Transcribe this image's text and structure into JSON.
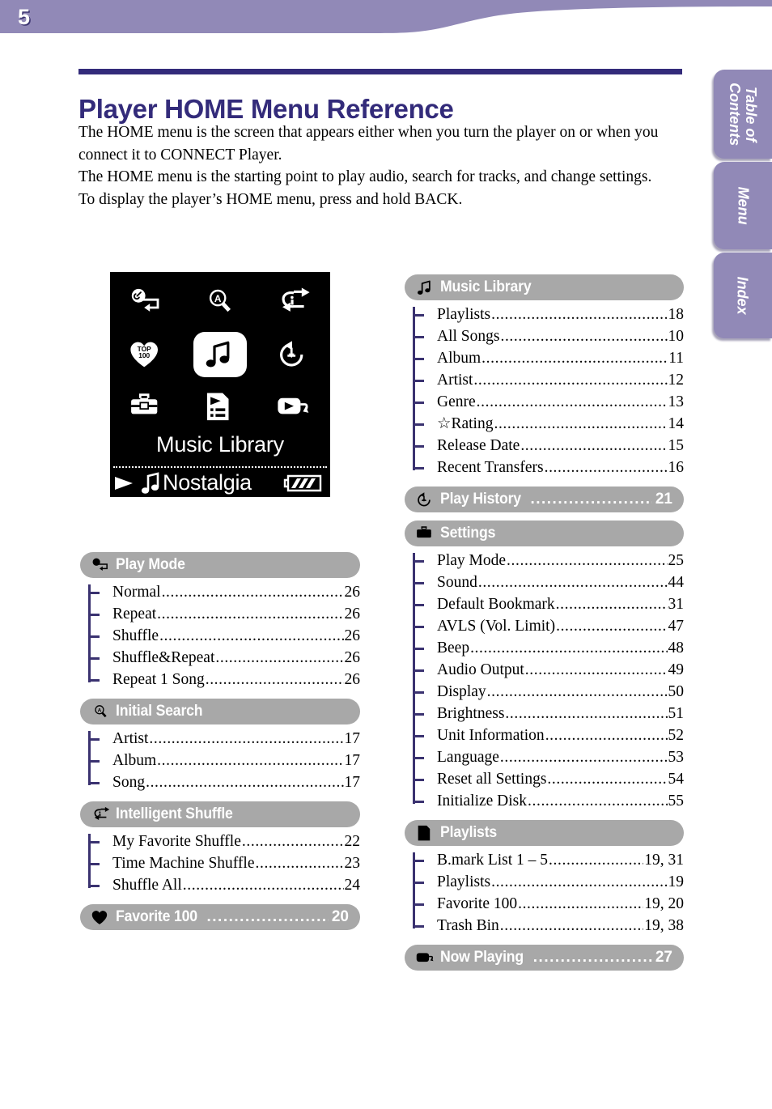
{
  "page": {
    "number": "5",
    "title": "Player HOME Menu Reference",
    "intro": "The HOME menu is the screen that appears either when you turn the player on or when you connect it to CONNECT Player.\nThe HOME menu is the starting point to play audio, search for tracks, and change settings.\nTo display the player’s HOME menu, press and hold BACK.",
    "accent_color": "#332b7a",
    "band_color": "#9189b7",
    "pill_color": "#a8a8a8",
    "tree_color": "#3a3270"
  },
  "side_tabs": [
    {
      "label": "Table of\nContents",
      "name": "table-of-contents"
    },
    {
      "label": "Menu",
      "name": "menu"
    },
    {
      "label": "Index",
      "name": "index"
    }
  ],
  "player_screen": {
    "icons": [
      "wrench-repeat-icon",
      "magnifier-a-icon",
      "intelligent-shuffle-icon",
      "heart-top100-icon",
      "music-note-icon",
      "play-history-icon",
      "toolbox-icon",
      "playlist-document-icon",
      "now-playing-icon"
    ],
    "selected_icon_index": 4,
    "title": "Music Library",
    "status_track": "Nostalgia",
    "status_icons": [
      "play-triangle-icon",
      "music-note-icon",
      "battery-icon"
    ]
  },
  "columns": {
    "left": [
      {
        "name": "play-mode",
        "icon": "wrench-repeat-icon",
        "label": "Play Mode",
        "page": "",
        "items": [
          {
            "label": "Normal",
            "page": "26"
          },
          {
            "label": "Repeat",
            "page": "26"
          },
          {
            "label": "Shuffle",
            "page": "26"
          },
          {
            "label": "Shuffle&Repeat",
            "page": "26"
          },
          {
            "label": "Repeat 1 Song",
            "page": "26"
          }
        ]
      },
      {
        "name": "initial-search",
        "icon": "magnifier-a-icon",
        "label": "Initial Search",
        "page": "",
        "items": [
          {
            "label": "Artist",
            "page": "17"
          },
          {
            "label": "Album",
            "page": "17"
          },
          {
            "label": "Song",
            "page": "17"
          }
        ]
      },
      {
        "name": "intelligent-shuffle",
        "icon": "intelligent-shuffle-icon",
        "label": "Intelligent Shuffle",
        "page": "",
        "items": [
          {
            "label": "My Favorite Shuffle",
            "page": "22"
          },
          {
            "label": "Time Machine Shuffle",
            "page": "23"
          },
          {
            "label": "Shuffle All",
            "page": "24"
          }
        ]
      },
      {
        "name": "favorite-100",
        "icon": "heart-top100-icon",
        "label": "Favorite 100",
        "page": "20",
        "items": []
      }
    ],
    "right": [
      {
        "name": "music-library",
        "icon": "music-note-icon",
        "label": "Music Library",
        "page": "",
        "items": [
          {
            "label": "Playlists",
            "page": "18"
          },
          {
            "label": "All Songs",
            "page": "10"
          },
          {
            "label": "Album",
            "page": "11"
          },
          {
            "label": "Artist",
            "page": "12"
          },
          {
            "label": "Genre",
            "page": "13"
          },
          {
            "label": "☆Rating",
            "page": "14"
          },
          {
            "label": "Release Date",
            "page": "15"
          },
          {
            "label": "Recent Transfers",
            "page": "16"
          }
        ]
      },
      {
        "name": "play-history",
        "icon": "play-history-icon",
        "label": "Play History",
        "page": "21",
        "items": []
      },
      {
        "name": "settings",
        "icon": "toolbox-icon",
        "label": "Settings",
        "page": "",
        "items": [
          {
            "label": "Play Mode",
            "page": "25"
          },
          {
            "label": "Sound",
            "page": "44"
          },
          {
            "label": "Default Bookmark",
            "page": "31"
          },
          {
            "label": "AVLS (Vol. Limit)",
            "page": "47"
          },
          {
            "label": "Beep",
            "page": "48"
          },
          {
            "label": "Audio Output",
            "page": "49"
          },
          {
            "label": "Display",
            "page": "50"
          },
          {
            "label": "Brightness",
            "page": "51"
          },
          {
            "label": "Unit Information",
            "page": "52"
          },
          {
            "label": "Language",
            "page": "53"
          },
          {
            "label": "Reset all Settings",
            "page": "54"
          },
          {
            "label": "Initialize Disk",
            "page": "55"
          }
        ]
      },
      {
        "name": "playlists",
        "icon": "playlist-document-icon",
        "label": "Playlists",
        "page": "",
        "items": [
          {
            "label": "B.mark List 1 – 5",
            "page": "19, 31"
          },
          {
            "label": "Playlists",
            "page": "19"
          },
          {
            "label": "Favorite 100",
            "page": "19, 20"
          },
          {
            "label": "Trash Bin",
            "page": "19, 38"
          }
        ]
      },
      {
        "name": "now-playing",
        "icon": "now-playing-icon",
        "label": "Now Playing",
        "page": "27",
        "items": []
      }
    ]
  }
}
